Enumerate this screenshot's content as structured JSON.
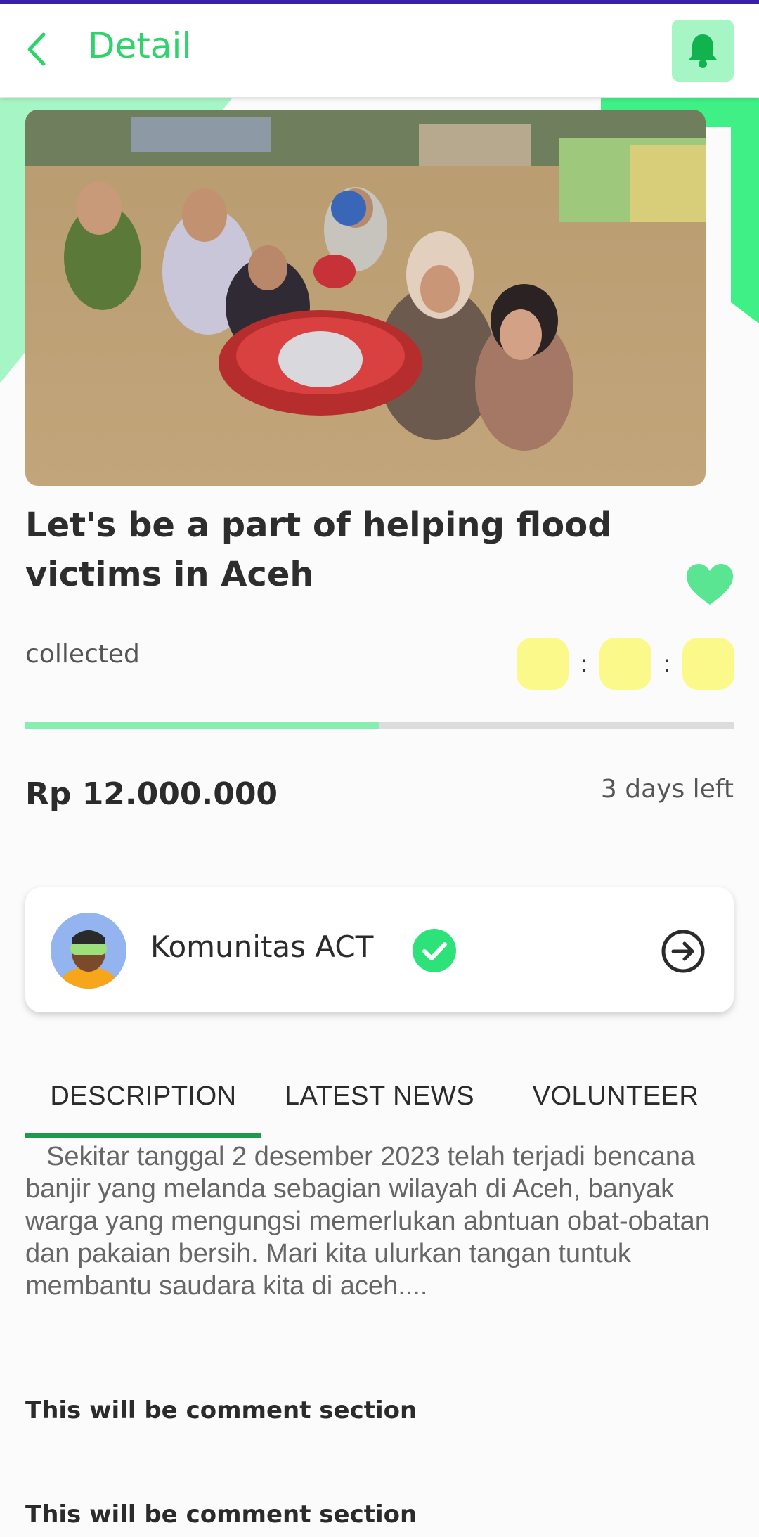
{
  "app_bar": {
    "title": "Detail",
    "back_icon": "chevron-left-icon",
    "notification_icon": "bell-icon"
  },
  "hero": {
    "image": "flood-victims-photo"
  },
  "campaign": {
    "title": "Let's be a part of helping flood victims in Aceh",
    "favorite_icon": "heart-icon",
    "collected_label": "collected",
    "timer_separator": ":",
    "progress": 0.5,
    "amount": "Rp 12.000.000",
    "days_left": "3 days left"
  },
  "organizer": {
    "name": "Komunitas ACT",
    "avatar_icon": "avatar",
    "verified_icon": "verified-check-icon",
    "open_icon": "arrow-right-circle-icon"
  },
  "tabs": [
    {
      "label": "DESCRIPTION",
      "active": true
    },
    {
      "label": "LATEST NEWS",
      "active": false
    },
    {
      "label": "VOLUNTEER",
      "active": false
    }
  ],
  "description": "Sekitar tanggal 2 desember 2023 telah terjadi bencana banjir yang melanda sebagian wilayah di Aceh, banyak warga yang mengungsi memerlukan abntuan obat-obatan dan pakaian bersih. Mari kita ulurkan tangan tuntuk membantu saudara kita di aceh....",
  "comments": [
    "This will be comment section",
    "This will be comment section"
  ],
  "colors": {
    "accent": "#2fd36b",
    "accent_light": "#a6f5c4",
    "timer_box": "#fbf98a",
    "progress_fill": "#86eeb0",
    "tab_indicator": "#1f9a4a",
    "status_bar": "#3b1fa8"
  }
}
